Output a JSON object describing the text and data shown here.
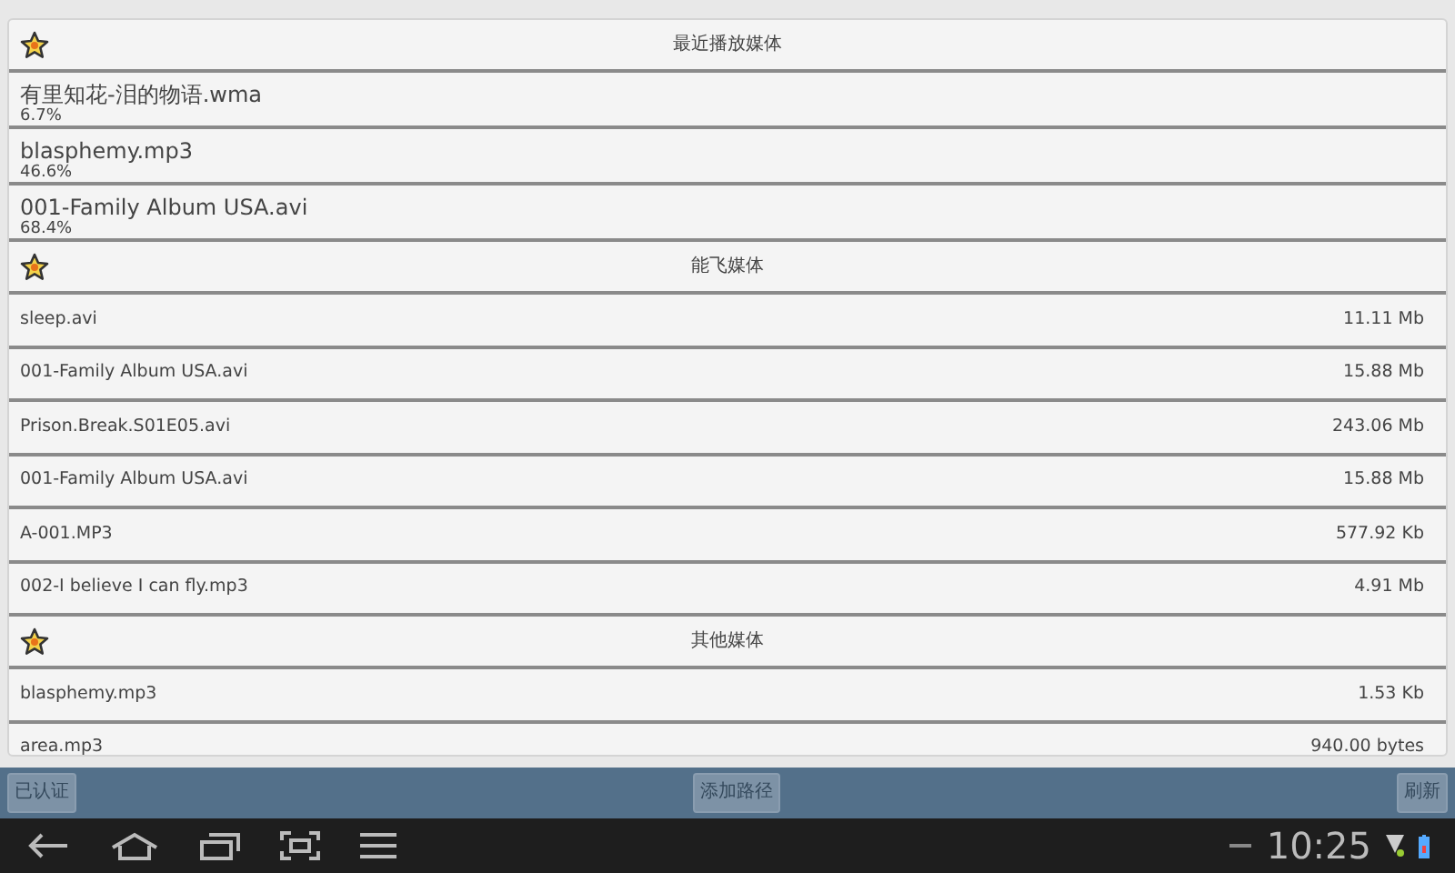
{
  "sections": [
    {
      "title": "最近播放媒体",
      "kind": "recent",
      "items": [
        {
          "name": "有里知花-泪的物语.wma",
          "detail": "6.7%"
        },
        {
          "name": "blasphemy.mp3",
          "detail": "46.6%"
        },
        {
          "name": "001-Family Album USA.avi",
          "detail": "68.4%"
        }
      ]
    },
    {
      "title": "能飞媒体",
      "kind": "files",
      "items": [
        {
          "name": "sleep.avi",
          "detail": "11.11 Mb"
        },
        {
          "name": "001-Family Album USA.avi",
          "detail": "15.88 Mb"
        },
        {
          "name": "Prison.Break.S01E05.avi",
          "detail": "243.06 Mb"
        },
        {
          "name": "001-Family Album USA.avi",
          "detail": "15.88 Mb"
        },
        {
          "name": "A-001.MP3",
          "detail": "577.92 Kb"
        },
        {
          "name": "002-I believe I can fly.mp3",
          "detail": "4.91 Mb"
        }
      ]
    },
    {
      "title": "其他媒体",
      "kind": "files",
      "items": [
        {
          "name": "blasphemy.mp3",
          "detail": "1.53 Kb"
        },
        {
          "name": "area.mp3",
          "detail": "940.00 bytes"
        }
      ]
    }
  ],
  "toolbar": [
    {
      "label": "已认证",
      "disabled": true
    },
    {
      "label": "添加路径",
      "disabled": true
    },
    {
      "label": "刷新",
      "disabled": true
    }
  ],
  "status_bar": {
    "time": "10:25"
  }
}
